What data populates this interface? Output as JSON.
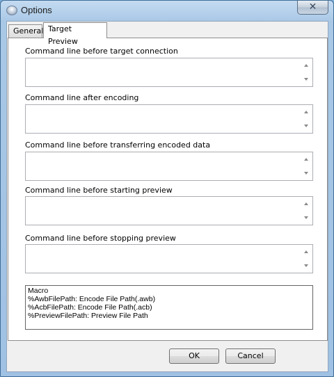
{
  "window": {
    "title": "Options",
    "close_glyph": "✕"
  },
  "tabs": [
    {
      "label": "General",
      "selected": false
    },
    {
      "label": "Target Preview",
      "selected": true
    }
  ],
  "fields": [
    {
      "label": "Command line before target connection",
      "value": ""
    },
    {
      "label": "Command line after encoding",
      "value": ""
    },
    {
      "label": "Command line before transferring encoded data",
      "value": ""
    },
    {
      "label": "Command line before starting preview",
      "value": ""
    },
    {
      "label": "Command line before stopping preview",
      "value": ""
    }
  ],
  "macro": {
    "title": "Macro",
    "lines": [
      "%AwbFilePath: Encode File Path(.awb)",
      "%AcbFilePath: Encode File Path(.acb)",
      "%PreviewFilePath: Preview File Path"
    ]
  },
  "buttons": {
    "ok": "OK",
    "cancel": "Cancel"
  },
  "icons": {
    "app": "app-orb-icon",
    "close": "close-icon",
    "scroll_up": "scroll-up-arrow-icon",
    "scroll_down": "scroll-down-arrow-icon"
  }
}
